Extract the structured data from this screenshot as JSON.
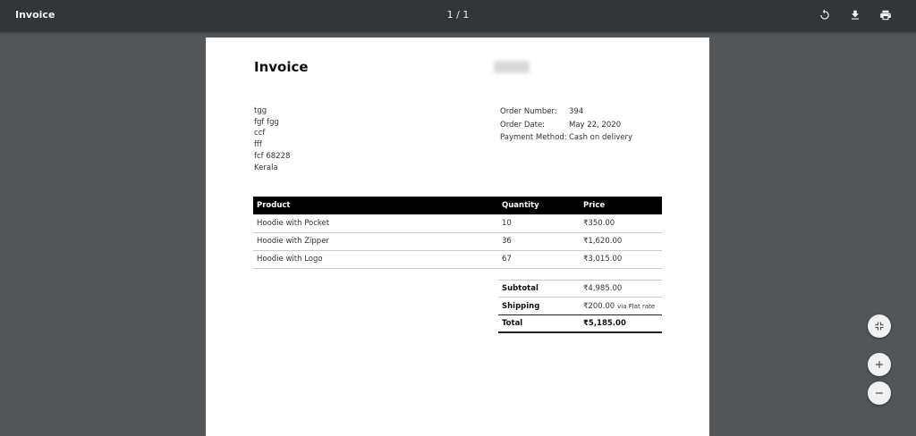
{
  "toolbar": {
    "title": "Invoice",
    "page_indicator": "1 / 1",
    "icons": [
      "rotate-icon",
      "download-icon",
      "print-icon"
    ]
  },
  "invoice": {
    "heading": "Invoice",
    "address": [
      "tgg",
      "fgf fgg",
      "ccf",
      "fff",
      "fcf 68228",
      "Kerala"
    ],
    "order": {
      "number_label": "Order Number:",
      "number": "394",
      "date_label": "Order Date:",
      "date": "May 22, 2020",
      "payment_label": "Payment Method:",
      "payment": "Cash on delivery"
    },
    "table": {
      "headers": [
        "Product",
        "Quantity",
        "Price"
      ],
      "rows": [
        [
          "Hoodie with Pocket",
          "10",
          "₹350.00"
        ],
        [
          "Hoodie with Zipper",
          "36",
          "₹1,620.00"
        ],
        [
          "Hoodie with Logo",
          "67",
          "₹3,015.00"
        ]
      ]
    },
    "totals": {
      "subtotal_label": "Subtotal",
      "subtotal": "₹4,985.00",
      "shipping_label": "Shipping",
      "shipping": "₹200.00",
      "shipping_note": "via Flat rate",
      "total_label": "Total",
      "total": "₹5,185.00"
    }
  },
  "controls": [
    "fit-page-icon",
    "zoom-in-icon",
    "zoom-out-icon"
  ]
}
